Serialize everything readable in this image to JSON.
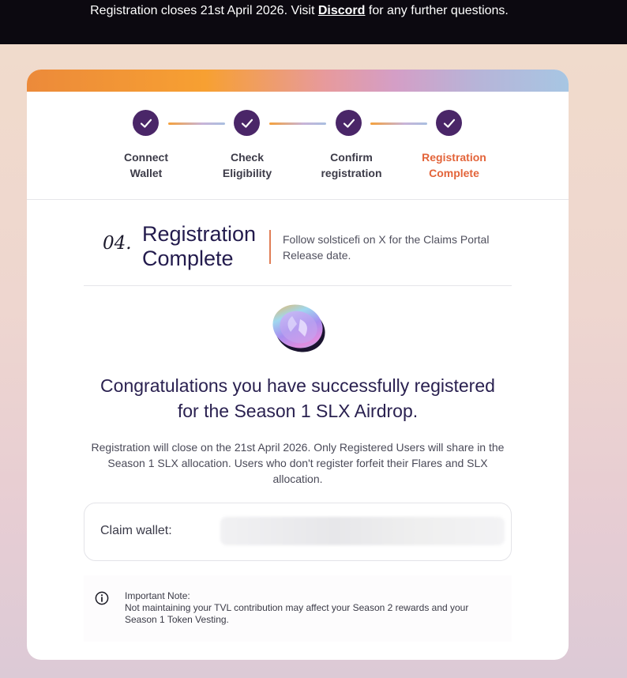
{
  "banner": {
    "text_before": "Registration closes 21st April 2026. Visit ",
    "link": "Discord",
    "text_after": " for any further questions."
  },
  "steps": [
    {
      "label_line1": "Connect",
      "label_line2": "Wallet",
      "completed": true,
      "active": false
    },
    {
      "label_line1": "Check",
      "label_line2": "Eligibility",
      "completed": true,
      "active": false
    },
    {
      "label_line1": "Confirm",
      "label_line2": "registration",
      "completed": true,
      "active": false
    },
    {
      "label_line1": "Registration",
      "label_line2": "Complete",
      "completed": true,
      "active": true
    }
  ],
  "section": {
    "number": "04.",
    "title_line1": "Registration",
    "title_line2": "Complete",
    "description": "Follow solsticefi on X for the Claims Portal Release date."
  },
  "congrats": {
    "line1": "Congratulations you have successfully registered",
    "line2": "for the Season 1 SLX Airdrop."
  },
  "info_text": "Registration will close on the 21st April 2026. Only Registered Users will share in the Season 1 SLX allocation. Users who don't register forfeit their Flares and SLX allocation.",
  "wallet": {
    "label": "Claim wallet:",
    "value": ""
  },
  "note": {
    "title": "Important Note:",
    "body": "Not maintaining your TVL contribution may affect your Season 2 rewards and your Season 1 Token Vesting."
  },
  "colors": {
    "banner_bg": "#0c0910",
    "step_circle": "#4a2668",
    "active_step": "#e3643a",
    "heading": "#231b4d"
  },
  "icons": {
    "step": "check-icon",
    "note": "info-icon",
    "logo": "solstice-coin-icon"
  }
}
